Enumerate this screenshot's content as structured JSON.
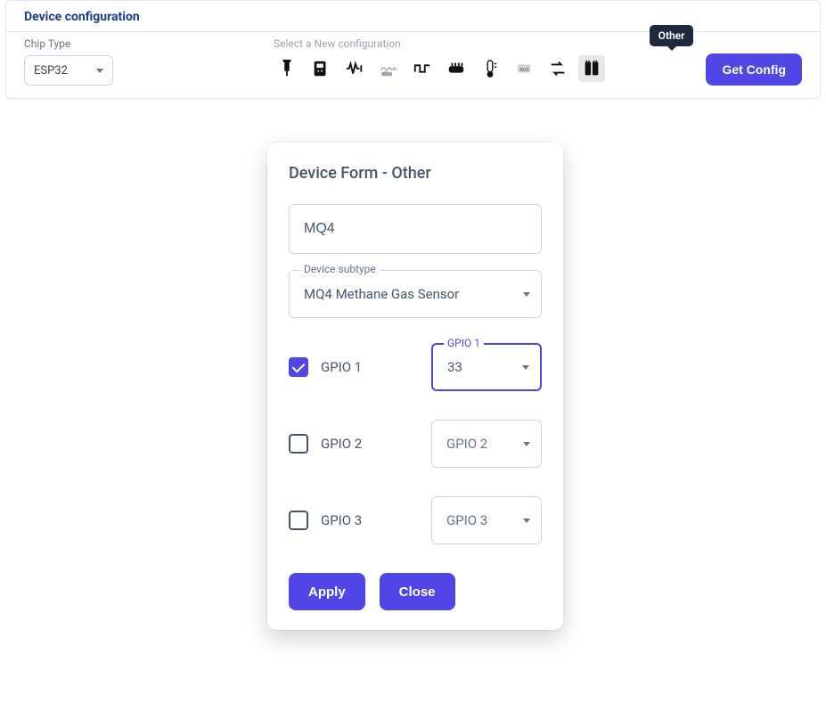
{
  "panel": {
    "title": "Device configuration",
    "chip_type_label": "Chip Type",
    "chip_type_value": "ESP32",
    "new_config_label": "Select a New configuration",
    "tooltip": "Other",
    "get_config": "Get Config"
  },
  "modal": {
    "title": "Device Form - Other",
    "name_value": "MQ4",
    "subtype_label": "Device subtype",
    "subtype_value": "MQ4 Methane Gas Sensor",
    "gpio": [
      {
        "label": "GPIO 1",
        "checked": true,
        "float_label": "GPIO 1",
        "value": "33",
        "focused": true,
        "placeholder": false
      },
      {
        "label": "GPIO 2",
        "checked": false,
        "float_label": "",
        "value": "GPIO 2",
        "focused": false,
        "placeholder": true
      },
      {
        "label": "GPIO 3",
        "checked": false,
        "float_label": "",
        "value": "GPIO 3",
        "focused": false,
        "placeholder": true
      }
    ],
    "apply": "Apply",
    "close": "Close"
  }
}
